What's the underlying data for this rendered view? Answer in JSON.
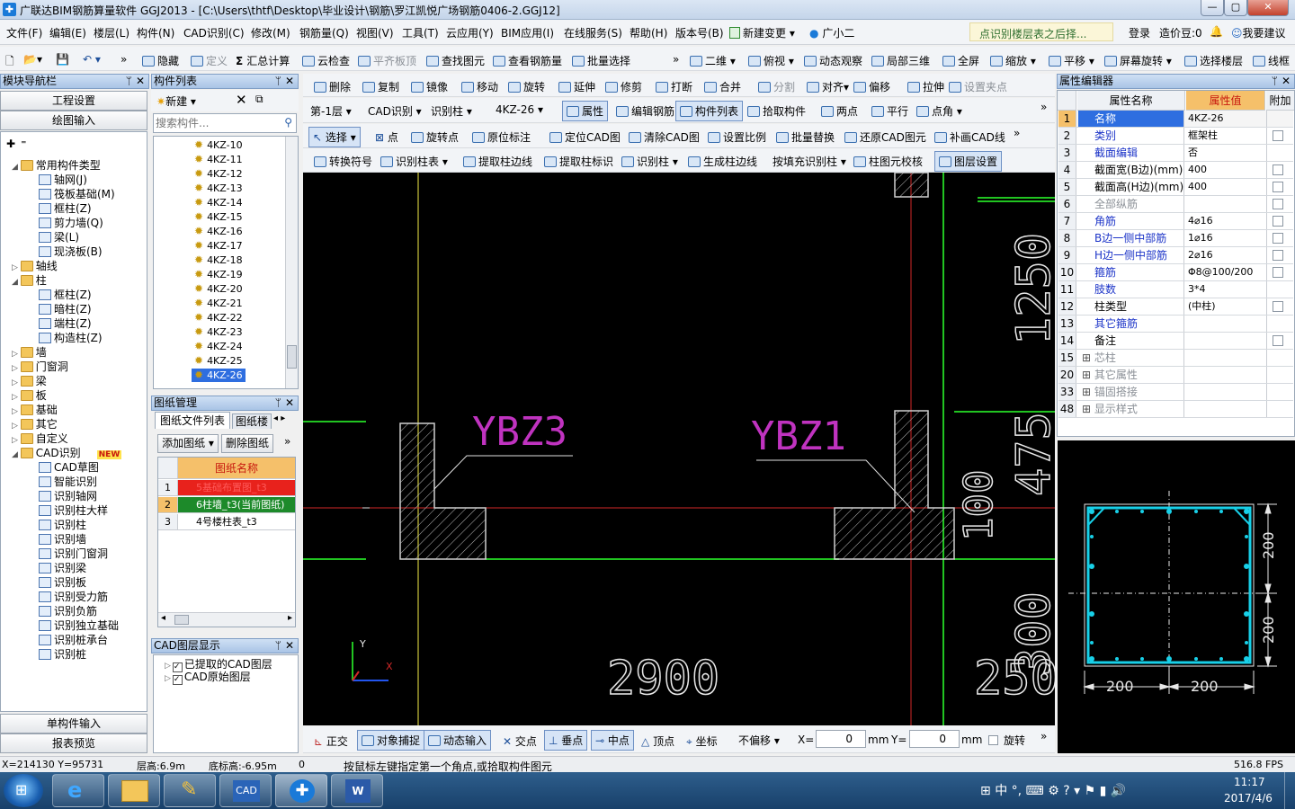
{
  "window": {
    "title": "广联达BIM钢筋算量软件 GGJ2013 - [C:\\Users\\thtf\\Desktop\\毕业设计\\钢筋\\罗江凯悦广场钢筋0406-2.GGJ12]"
  },
  "menu": {
    "items": [
      "文件(F)",
      "编辑(E)",
      "楼层(L)",
      "构件(N)",
      "CAD识别(C)",
      "修改(M)",
      "钢筋量(Q)",
      "视图(V)",
      "工具(T)",
      "云应用(Y)",
      "BIM应用(I)",
      "在线服务(S)",
      "帮助(H)",
      "版本号(B)",
      "新建变更",
      "广小二"
    ],
    "hint": "点识别楼层表之后择...",
    "login": "登录",
    "cost_bean": "造价豆:0",
    "suggest": "我要建议"
  },
  "toolbar1": {
    "items": [
      "隐藏",
      "定义",
      "汇总计算",
      "云检查",
      "平齐板顶",
      "查找图元",
      "查看钢筋量",
      "批量选择",
      "二维",
      "俯视",
      "动态观察",
      "局部三维",
      "全屏",
      "缩放",
      "平移",
      "屏幕旋转",
      "选择楼层",
      "线框"
    ]
  },
  "toolbar2": {
    "items": [
      "删除",
      "复制",
      "镜像",
      "移动",
      "旋转",
      "延伸",
      "修剪",
      "打断",
      "合并",
      "分割",
      "对齐",
      "偏移",
      "拉伸",
      "设置夹点"
    ]
  },
  "toolbar3": {
    "floor": "第-1层",
    "category": "CAD识别",
    "type": "识别柱",
    "component": "4KZ-26",
    "items": [
      "属性",
      "编辑钢筋",
      "构件列表",
      "拾取构件",
      "两点",
      "平行",
      "点角"
    ]
  },
  "toolbar4": {
    "items": [
      "选择",
      "点",
      "旋转点",
      "原位标注",
      "定位CAD图",
      "清除CAD图",
      "设置比例",
      "批量替换",
      "还原CAD图元",
      "补画CAD线"
    ]
  },
  "toolbar5": {
    "items": [
      "转换符号",
      "识别柱表",
      "提取柱边线",
      "提取柱标识",
      "识别柱",
      "生成柱边线",
      "按填充识别柱",
      "柱图元校核",
      "图层设置"
    ]
  },
  "nav": {
    "title": "模块导航栏",
    "btn_project": "工程设置",
    "btn_draw": "绘图输入",
    "btn_single": "单构件输入",
    "btn_report": "报表预览",
    "tree": [
      {
        "label": "常用构件类型",
        "level": 0,
        "kind": "folder",
        "exp": "-"
      },
      {
        "label": "轴网(J)",
        "level": 1,
        "kind": "comp"
      },
      {
        "label": "筏板基础(M)",
        "level": 1,
        "kind": "comp"
      },
      {
        "label": "框柱(Z)",
        "level": 1,
        "kind": "comp"
      },
      {
        "label": "剪力墙(Q)",
        "level": 1,
        "kind": "comp"
      },
      {
        "label": "梁(L)",
        "level": 1,
        "kind": "comp"
      },
      {
        "label": "现浇板(B)",
        "level": 1,
        "kind": "comp"
      },
      {
        "label": "轴线",
        "level": 0,
        "kind": "folder",
        "exp": "+"
      },
      {
        "label": "柱",
        "level": 0,
        "kind": "folder",
        "exp": "-"
      },
      {
        "label": "框柱(Z)",
        "level": 1,
        "kind": "comp"
      },
      {
        "label": "暗柱(Z)",
        "level": 1,
        "kind": "comp"
      },
      {
        "label": "端柱(Z)",
        "level": 1,
        "kind": "comp"
      },
      {
        "label": "构造柱(Z)",
        "level": 1,
        "kind": "comp"
      },
      {
        "label": "墙",
        "level": 0,
        "kind": "folder",
        "exp": "+"
      },
      {
        "label": "门窗洞",
        "level": 0,
        "kind": "folder",
        "exp": "+"
      },
      {
        "label": "梁",
        "level": 0,
        "kind": "folder",
        "exp": "+"
      },
      {
        "label": "板",
        "level": 0,
        "kind": "folder",
        "exp": "+"
      },
      {
        "label": "基础",
        "level": 0,
        "kind": "folder",
        "exp": "+"
      },
      {
        "label": "其它",
        "level": 0,
        "kind": "folder",
        "exp": "+"
      },
      {
        "label": "自定义",
        "level": 0,
        "kind": "folder",
        "exp": "+"
      },
      {
        "label": "CAD识别",
        "level": 0,
        "kind": "folder",
        "exp": "-"
      },
      {
        "label": "CAD草图",
        "level": 1,
        "kind": "comp"
      },
      {
        "label": "智能识别",
        "level": 1,
        "kind": "comp"
      },
      {
        "label": "识别轴网",
        "level": 1,
        "kind": "comp"
      },
      {
        "label": "识别柱大样",
        "level": 1,
        "kind": "comp"
      },
      {
        "label": "识别柱",
        "level": 1,
        "kind": "comp"
      },
      {
        "label": "识别墙",
        "level": 1,
        "kind": "comp"
      },
      {
        "label": "识别门窗洞",
        "level": 1,
        "kind": "comp"
      },
      {
        "label": "识别梁",
        "level": 1,
        "kind": "comp"
      },
      {
        "label": "识别板",
        "level": 1,
        "kind": "comp"
      },
      {
        "label": "识别受力筋",
        "level": 1,
        "kind": "comp"
      },
      {
        "label": "识别负筋",
        "level": 1,
        "kind": "comp"
      },
      {
        "label": "识别独立基础",
        "level": 1,
        "kind": "comp"
      },
      {
        "label": "识别桩承台",
        "level": 1,
        "kind": "comp"
      },
      {
        "label": "识别桩",
        "level": 1,
        "kind": "comp"
      }
    ],
    "new_badge": "NEW"
  },
  "components": {
    "title": "构件列表",
    "new_btn": "新建",
    "search_placeholder": "搜索构件...",
    "items": [
      "4KZ-10",
      "4KZ-11",
      "4KZ-12",
      "4KZ-13",
      "4KZ-14",
      "4KZ-15",
      "4KZ-16",
      "4KZ-17",
      "4KZ-18",
      "4KZ-19",
      "4KZ-20",
      "4KZ-21",
      "4KZ-22",
      "4KZ-23",
      "4KZ-24",
      "4KZ-25",
      "4KZ-26"
    ],
    "selected": "4KZ-26"
  },
  "drawings": {
    "title": "图纸管理",
    "tab1": "图纸文件列表",
    "tab2": "图纸楼",
    "add_btn": "添加图纸",
    "del_btn": "删除图纸",
    "col_header": "图纸名称",
    "rows": [
      {
        "no": "1",
        "name": "5基础布置图_t3",
        "bg": "#e8221c"
      },
      {
        "no": "2",
        "name": "6柱墙_t3(当前图纸)",
        "bg": "#1d8a2a"
      },
      {
        "no": "3",
        "name": "4号楼柱表_t3",
        "bg": "#ffffff"
      }
    ]
  },
  "layers": {
    "title": "CAD图层显示",
    "items": [
      "已提取的CAD图层",
      "CAD原始图层"
    ]
  },
  "cad": {
    "labels": {
      "ybz3": "YBZ3",
      "ybz1": "YBZ1",
      "dim_2900": "2900",
      "dim_100": "100",
      "dim_1250": "1250",
      "dim_475": "475",
      "dim_300": "300",
      "dim_250": "250"
    },
    "axis_y": "Y",
    "axis_x": "X"
  },
  "snapbar": {
    "items": [
      "正交",
      "对象捕捉",
      "动态输入",
      "交点",
      "垂点",
      "中点",
      "顶点",
      "坐标"
    ],
    "offset": "不偏移",
    "x_label": "X=",
    "x_value": "0",
    "y_label": "Y=",
    "y_value": "0",
    "unit": "mm",
    "rotate": "旋转"
  },
  "properties": {
    "title": "属性编辑器",
    "col_name": "属性名称",
    "col_value": "属性值",
    "col_extra": "附加",
    "rows": [
      {
        "no": "1",
        "name": "名称",
        "value": "4KZ-26",
        "color": "blue",
        "check": false
      },
      {
        "no": "2",
        "name": "类别",
        "value": "框架柱",
        "color": "blue",
        "check": true
      },
      {
        "no": "3",
        "name": "截面编辑",
        "value": "否",
        "color": "blue",
        "check": false
      },
      {
        "no": "4",
        "name": "截面宽(B边)(mm)",
        "value": "400",
        "color": "black",
        "check": true
      },
      {
        "no": "5",
        "name": "截面高(H边)(mm)",
        "value": "400",
        "color": "black",
        "check": true
      },
      {
        "no": "6",
        "name": "全部纵筋",
        "value": "",
        "color": "gray",
        "check": true
      },
      {
        "no": "7",
        "name": "角筋",
        "value": "4⌀16",
        "color": "blue",
        "check": true
      },
      {
        "no": "8",
        "name": "B边一侧中部筋",
        "value": "1⌀16",
        "color": "blue",
        "check": true
      },
      {
        "no": "9",
        "name": "H边一侧中部筋",
        "value": "2⌀16",
        "color": "blue",
        "check": true
      },
      {
        "no": "10",
        "name": "箍筋",
        "value": "Φ8@100/200",
        "color": "blue",
        "check": true
      },
      {
        "no": "11",
        "name": "肢数",
        "value": "3*4",
        "color": "blue",
        "check": false
      },
      {
        "no": "12",
        "name": "柱类型",
        "value": "(中柱)",
        "color": "black",
        "check": true
      },
      {
        "no": "13",
        "name": "其它箍筋",
        "value": "",
        "color": "blue",
        "check": false
      },
      {
        "no": "14",
        "name": "备注",
        "value": "",
        "color": "black",
        "check": true
      },
      {
        "no": "15",
        "name": "芯柱",
        "value": "",
        "color": "gray",
        "check": false,
        "exp": true
      },
      {
        "no": "20",
        "name": "其它属性",
        "value": "",
        "color": "gray",
        "check": false,
        "exp": true
      },
      {
        "no": "33",
        "name": "锚固搭接",
        "value": "",
        "color": "gray",
        "check": false,
        "exp": true
      },
      {
        "no": "48",
        "name": "显示样式",
        "value": "",
        "color": "gray",
        "check": false,
        "exp": true
      }
    ]
  },
  "preview": {
    "dim_w1": "200",
    "dim_w2": "200",
    "dim_h1": "200",
    "dim_h2": "200"
  },
  "status": {
    "coords": "X=214130 Y=95731",
    "floor_height": "层高:6.9m",
    "bottom_elev": "底标高:-6.95m",
    "zero": "0",
    "prompt": "按鼠标左键指定第一个角点,或拾取构件图元",
    "fps": "516.8 FPS"
  },
  "taskbar": {
    "time": "11:17",
    "date": "2017/4/6",
    "ime": "中"
  }
}
